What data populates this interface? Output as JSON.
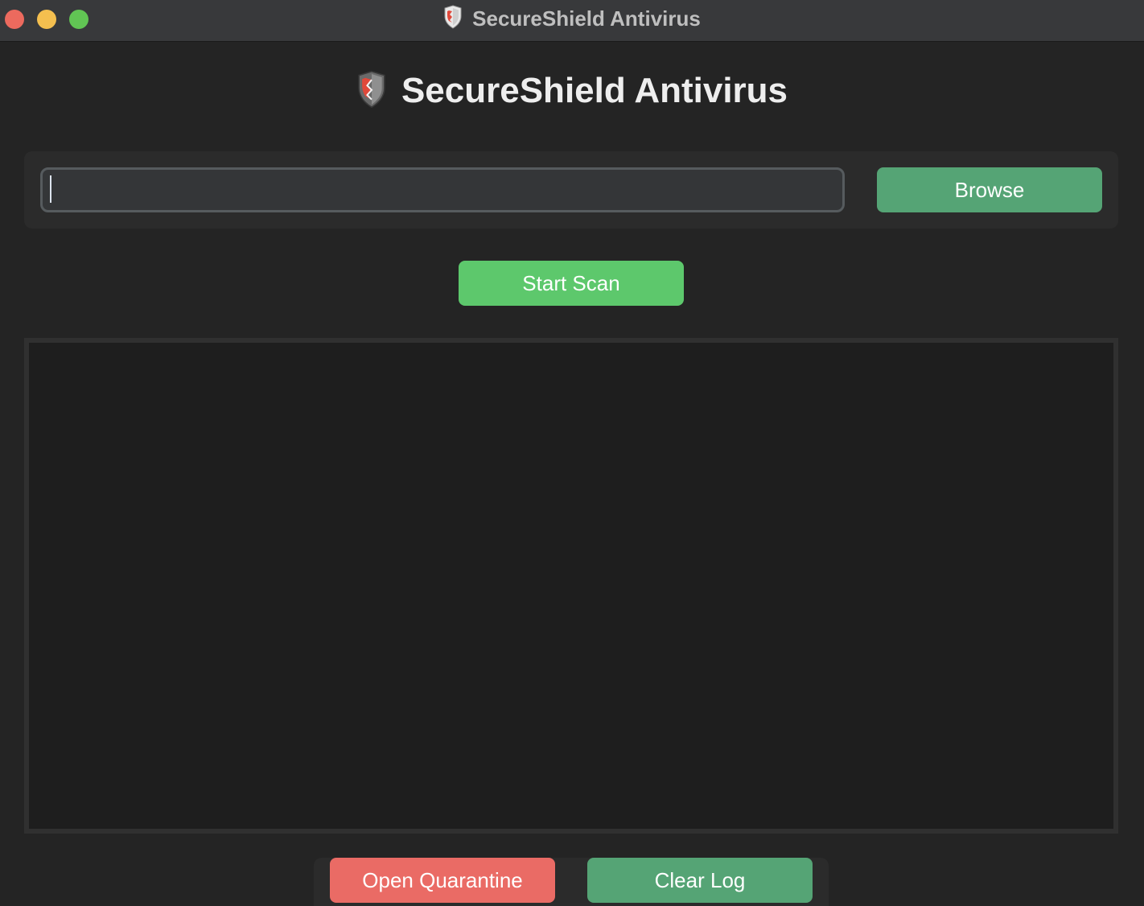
{
  "window": {
    "title": "SecureShield Antivirus",
    "controls": [
      "close",
      "minimize",
      "maximize"
    ]
  },
  "header": {
    "title": "SecureShield Antivirus",
    "icon": "shield-icon"
  },
  "path_panel": {
    "input_value": "",
    "browse_label": "Browse"
  },
  "scan": {
    "start_label": "Start Scan"
  },
  "log": {
    "content": ""
  },
  "footer": {
    "quarantine_label": "Open Quarantine",
    "clear_label": "Clear Log"
  },
  "colors": {
    "accent_green": "#55a475",
    "start_green": "#5dc86c",
    "danger_red": "#ea6b65",
    "background": "#242424"
  }
}
